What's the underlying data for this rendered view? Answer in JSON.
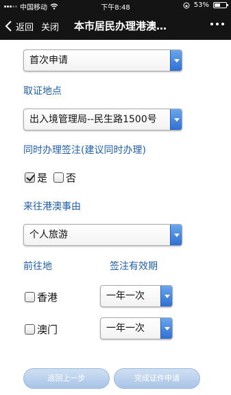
{
  "status_bar": {
    "carrier": "中国移动",
    "time": "下午8:48",
    "battery_percent": "53%",
    "battery_level": 0.53,
    "icons": [
      "signal-icon",
      "wifi-icon",
      "orientation-lock-icon",
      "battery-icon"
    ]
  },
  "nav": {
    "back_label": "返回",
    "close_label": "关闭",
    "title": "本市居民办理港澳…",
    "more_icon": "more-dots-icon"
  },
  "form": {
    "apply_type": "首次申请",
    "pickup_label": "取证地点",
    "pickup_location": "出入境管理局--民生路1500号",
    "visa_label": "同时办理签注(建议同时办理)",
    "yes_label": "是",
    "no_label": "否",
    "yes_checked": true,
    "no_checked": false,
    "reason_label": "来往港澳事由",
    "reason": "个人旅游",
    "destination_header": "前往地",
    "validity_header": "签注有效期",
    "destinations": [
      {
        "name": "香港",
        "checked": false,
        "validity": "一年一次"
      },
      {
        "name": "澳门",
        "checked": false,
        "validity": "一年一次"
      }
    ]
  },
  "buttons": {
    "back_step": "返回上一步",
    "submit": "完成证件申请"
  },
  "colors": {
    "label_blue": "#1f5fa8",
    "select_arrow_blue": "#2f6fd3",
    "button_light_blue": "#b6cdea",
    "bar_black": "#141414"
  }
}
